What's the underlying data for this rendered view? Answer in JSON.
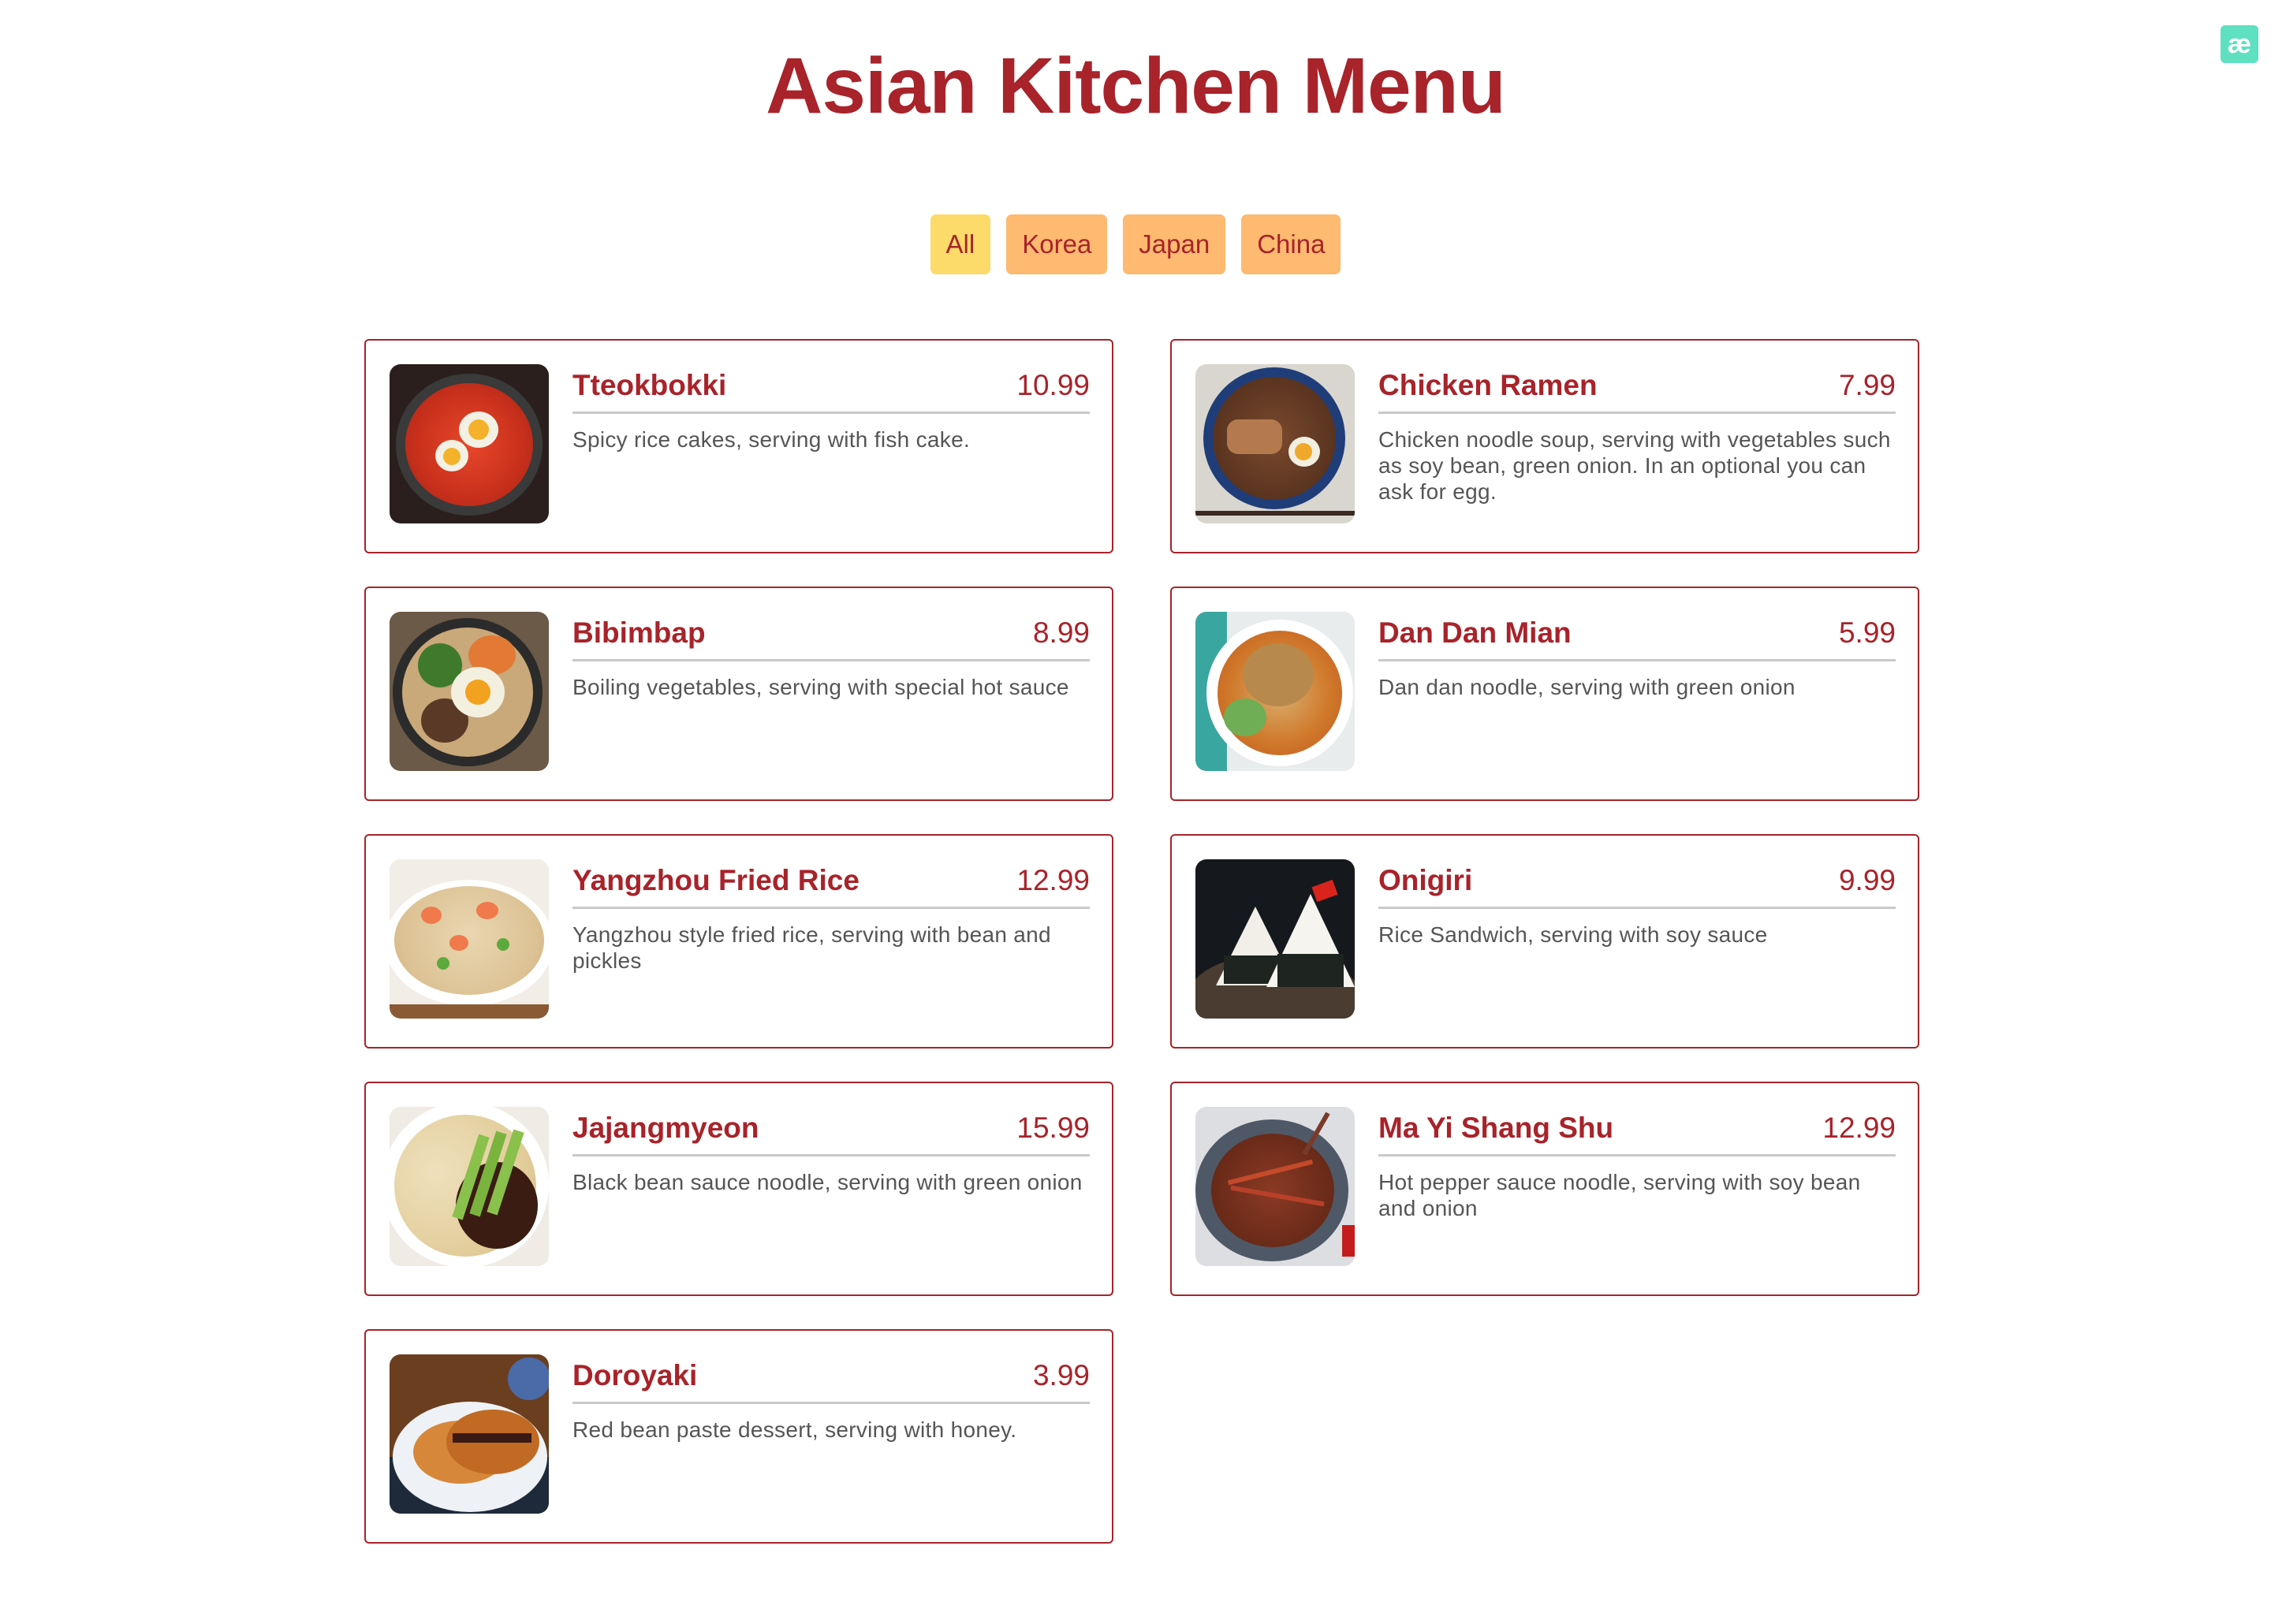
{
  "badge": {
    "text": "æ",
    "color": "#5fe0c0"
  },
  "title": "Asian Kitchen Menu",
  "colors": {
    "accent": "#a8232a",
    "filter": "#fdba70",
    "filter_active": "#fddb6a"
  },
  "filters": [
    {
      "label": "All",
      "active": true
    },
    {
      "label": "Korea",
      "active": false
    },
    {
      "label": "Japan",
      "active": false
    },
    {
      "label": "China",
      "active": false
    }
  ],
  "menu": [
    {
      "name": "Tteokbokki",
      "price": "10.99",
      "description": "Spicy rice cakes, serving with fish cake.",
      "photo": "tteokbokki-photo"
    },
    {
      "name": "Chicken Ramen",
      "price": "7.99",
      "description": "Chicken noodle soup, serving with vegetables such as soy bean, green onion. In an optional you can ask for egg.",
      "photo": "chicken-ramen-photo"
    },
    {
      "name": "Bibimbap",
      "price": "8.99",
      "description": "Boiling vegetables, serving with special hot sauce",
      "photo": "bibimbap-photo"
    },
    {
      "name": "Dan Dan Mian",
      "price": "5.99",
      "description": "Dan dan noodle, serving with green onion",
      "photo": "dan-dan-mian-photo"
    },
    {
      "name": "Yangzhou Fried Rice",
      "price": "12.99",
      "description": "Yangzhou style fried rice, serving with bean and pickles",
      "photo": "yangzhou-fried-rice-photo"
    },
    {
      "name": "Onigiri",
      "price": "9.99",
      "description": "Rice Sandwich, serving with soy sauce",
      "photo": "onigiri-photo"
    },
    {
      "name": "Jajangmyeon",
      "price": "15.99",
      "description": "Black bean sauce noodle, serving with green onion",
      "photo": "jajangmyeon-photo"
    },
    {
      "name": "Ma Yi Shang Shu",
      "price": "12.99",
      "description": "Hot pepper sauce noodle, serving with soy bean and onion",
      "photo": "ma-yi-shang-shu-photo"
    },
    {
      "name": "Doroyaki",
      "price": "3.99",
      "description": "Red bean paste dessert, serving with honey.",
      "photo": "doroyaki-photo"
    }
  ]
}
